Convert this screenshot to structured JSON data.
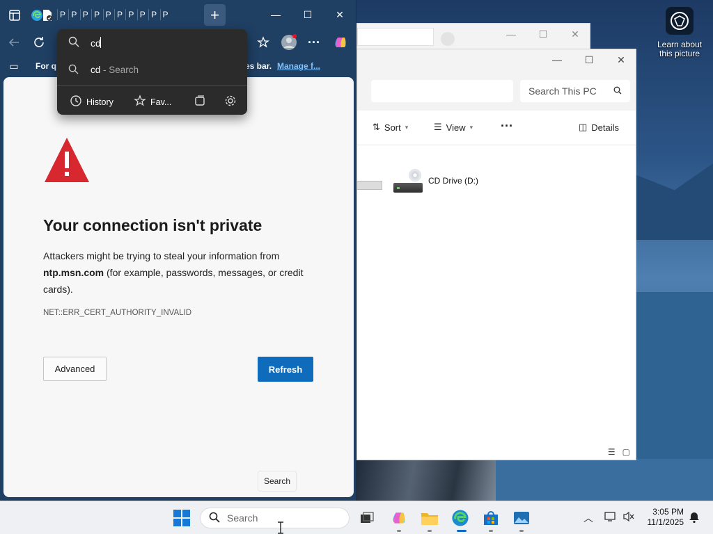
{
  "desktop": {
    "icon_label": "Learn about this picture"
  },
  "browser": {
    "tab_letter": "P",
    "tab_count": 10,
    "new_tab": "+",
    "omnibox": {
      "query": "cd",
      "suggestion_query": "cd",
      "suggestion_suffix": " - Search",
      "footer": {
        "history": "History",
        "favorites": "Fav..."
      }
    },
    "favorites_bar": {
      "prefix": "For q",
      "suffix": "es bar.",
      "manage_link": "Manage f..."
    },
    "error": {
      "title": "Your connection isn't private",
      "desc_before": "Attackers might be trying to steal your information from ",
      "domain": "ntp.msn.com",
      "desc_after": " (for example, passwords, messages, or credit cards).",
      "code": "NET::ERR_CERT_AUTHORITY_INVALID",
      "advanced": "Advanced",
      "refresh": "Refresh",
      "search": "Search"
    }
  },
  "explorer": {
    "search_placeholder": "Search This PC",
    "sort": "Sort",
    "view": "View",
    "more": "···",
    "details": "Details",
    "drive_label": "CD Drive (D:)"
  },
  "taskbar": {
    "search_placeholder": "Search",
    "time": "3:05 PM",
    "date": "11/1/2025"
  },
  "colors": {
    "accent": "#0f6cbd",
    "browser_frame": "#1f3f63",
    "warning_red": "#d7282f"
  }
}
